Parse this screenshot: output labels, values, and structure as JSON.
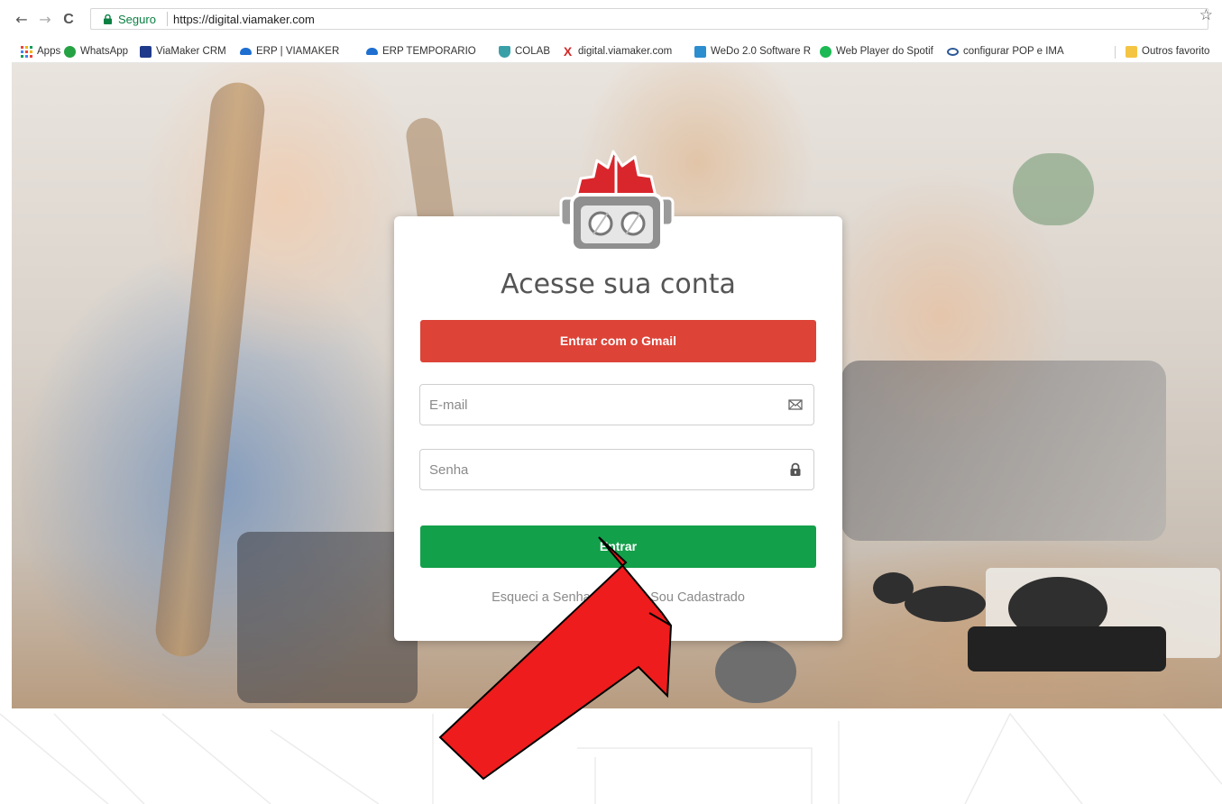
{
  "browser": {
    "nav": {
      "back": "←",
      "forward": "→",
      "reload": "C"
    },
    "omnibox": {
      "secure_label": "Seguro",
      "url": "https://digital.viamaker.com"
    },
    "bookmarks": [
      {
        "label": "Apps",
        "icon": "apps-grid-icon",
        "color": "#e8453c"
      },
      {
        "label": "WhatsApp",
        "icon": "whatsapp-icon",
        "color": "#25a244"
      },
      {
        "label": "ViaMaker CRM",
        "icon": "viamaker-icon",
        "color": "#1f3a8a"
      },
      {
        "label": "ERP | VIAMAKER",
        "icon": "cloud-icon",
        "color": "#1f6fd1"
      },
      {
        "label": "ERP TEMPORARIO",
        "icon": "cloud-icon",
        "color": "#1f6fd1"
      },
      {
        "label": "COLAB",
        "icon": "shield-icon",
        "color": "#3aa0a8"
      },
      {
        "label": "digital.viamaker.com",
        "icon": "x-logo-icon",
        "color": "#d42a2a"
      },
      {
        "label": "WeDo 2.0 Software R",
        "icon": "wedo-icon",
        "color": "#2d8ecf"
      },
      {
        "label": "Web Player do Spotif",
        "icon": "spotify-icon",
        "color": "#1db954"
      },
      {
        "label": "configurar POP e IMA",
        "icon": "link-icon",
        "color": "#2b5797"
      }
    ],
    "other_bookmarks": {
      "label": "Outros favorito",
      "icon": "folder-icon",
      "color": "#f4c542"
    }
  },
  "login": {
    "title": "Acesse sua conta",
    "gmail_button": "Entrar com o Gmail",
    "email_placeholder": "E-mail",
    "password_placeholder": "Senha",
    "submit_button": "Entrar",
    "forgot_link": "Esqueci a Senha",
    "separator": "|",
    "register_link": "Não Sou Cadastrado"
  },
  "colors": {
    "gmail": "#dd4337",
    "submit": "#13a04a",
    "arrow": "#ee1c1c",
    "logo_red": "#d8262c"
  }
}
